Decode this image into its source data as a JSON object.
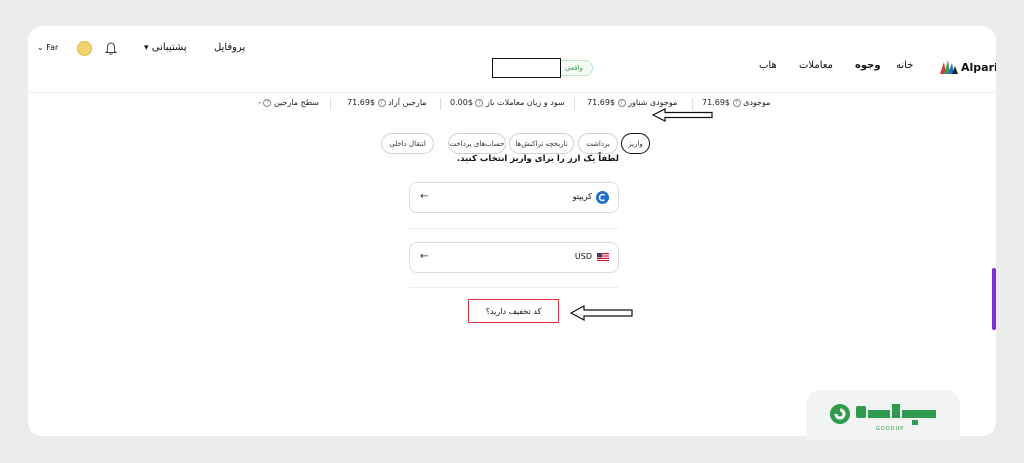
{
  "header": {
    "brand": "Alpari",
    "nav": [
      {
        "label": "خانه"
      },
      {
        "label": "وجوه"
      },
      {
        "label": "معاملات"
      },
      {
        "label": "هاب"
      }
    ],
    "account_badge": "واقعی",
    "profile_label": "پروفایل",
    "support_label": "پشتیبانی",
    "language": "Far"
  },
  "stats": [
    {
      "label": "موجودی",
      "value": "$71.69"
    },
    {
      "label": "موجودی شناور",
      "value": "$71.69"
    },
    {
      "label": "سود و زیان معاملات باز",
      "value": "$0.00"
    },
    {
      "label": "مارجین آزاد",
      "value": "$71.69"
    },
    {
      "label": "سطح مارجین",
      "value": "-"
    }
  ],
  "tabs": [
    {
      "label": "واریز"
    },
    {
      "label": "برداشت"
    },
    {
      "label": "تاریخچه تراکنش‌ها"
    },
    {
      "label": "حساب‌های پرداخت"
    },
    {
      "label": "انتقال داخلی"
    }
  ],
  "deposit": {
    "heading": "لطفاً یک ارز را برای واریز انتخاب کنید.",
    "options": [
      {
        "label": "کریپتو",
        "icon": "crypto-coin-icon"
      },
      {
        "label": "USD",
        "icon": "us-flag-icon"
      }
    ],
    "promo": "کد تخفیف دارید؟"
  },
  "watermark": {
    "text": "GOODUP"
  },
  "colors": {
    "accent": "#7b2fd6",
    "highlight": "#d9363e",
    "badge_green": "#3c9f4f",
    "crypto_blue": "#1f6fd1"
  }
}
